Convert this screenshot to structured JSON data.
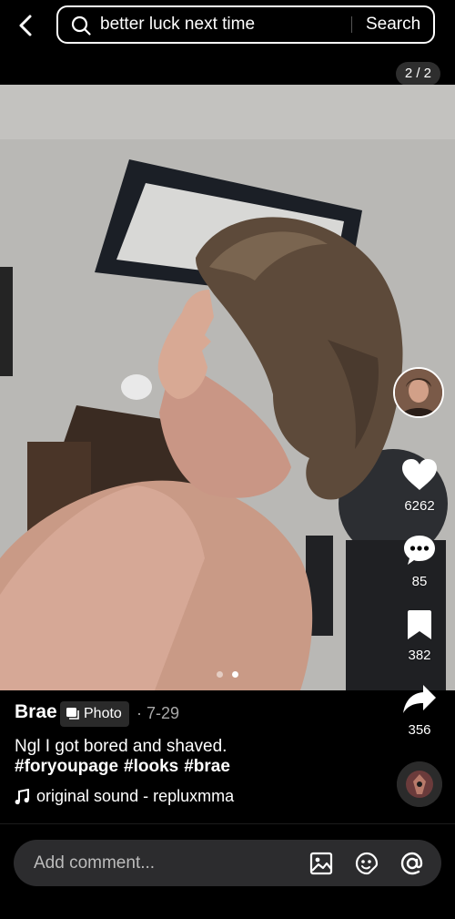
{
  "header": {
    "search_query": "better luck next time",
    "search_button_label": "Search",
    "page_counter": "2 / 2"
  },
  "carousel": {
    "total_slides": 2,
    "active_slide": 2
  },
  "actions": {
    "likes": "6262",
    "comments": "85",
    "bookmarks": "382",
    "shares": "356"
  },
  "post": {
    "author": "Brae",
    "type_badge": "Photo",
    "date": "· 7-29",
    "caption": "Ngl I got bored and shaved.",
    "hashtags": [
      "#foryoupage",
      "#looks",
      "#brae"
    ],
    "sound": "original sound - repluxmma"
  },
  "comment_bar": {
    "placeholder": "Add comment..."
  },
  "icons": {
    "back": "chevron-left-icon",
    "search": "search-icon",
    "like": "heart-icon",
    "comment": "comment-bubble-icon",
    "bookmark": "bookmark-icon",
    "share": "share-arrow-icon",
    "music": "music-note-icon",
    "image": "image-icon",
    "emoji": "emoji-icon",
    "mention": "at-sign-icon"
  },
  "colors": {
    "background": "#000000",
    "comment_bar": "#2c2c2e",
    "text_secondary": "#a8a8a8"
  }
}
